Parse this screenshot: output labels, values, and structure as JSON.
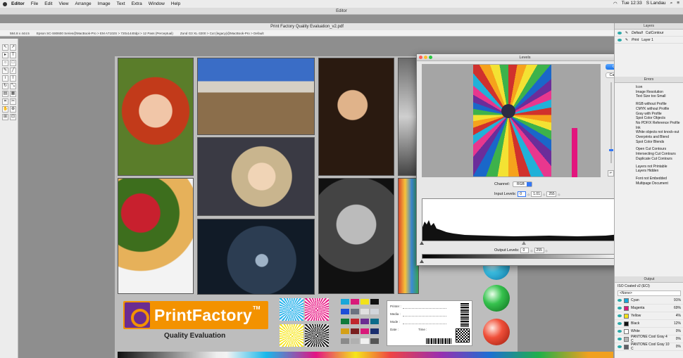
{
  "menubar": {
    "items": [
      "Editor",
      "File",
      "Edit",
      "View",
      "Arrange",
      "Image",
      "Text",
      "Extra",
      "Window",
      "Help"
    ],
    "clock": "Tue 12:33",
    "user": "S Landau"
  },
  "app_window": {
    "title": "Editor"
  },
  "document": {
    "title": "Print Factory Quality Evaluation_v2.pdf",
    "info": [
      "584.8 x 444.5",
      "Epson SC-S80600 Series@MacBook-Pro > EM A7102S > 720x1440dpi > 12 Pass (Perceptual)",
      "Zund G3 XL-3200 > Cut (legacy)@MacBook-Pro > Default"
    ]
  },
  "test_page": {
    "logo_text": "PrintFactory",
    "logo_tm": "TM",
    "subtitle": "Quality Evaluation",
    "form_fields": [
      "Printer :",
      "Media :",
      "Mode :",
      "Date :"
    ],
    "time_field": "Time :"
  },
  "levels_dialog": {
    "title": "Levels",
    "ok_label": "OK",
    "cancel_label": "Cancel",
    "zoom_max": "100%",
    "zoom_min": "4%",
    "channel_label": "Channel:",
    "channel_value": "RGB",
    "input_label": "Input Levels:",
    "input_black": "0",
    "input_gamma": "1.01",
    "input_white": "255",
    "output_label": "Output Levels:",
    "output_black": "0",
    "output_white": "255"
  },
  "layers_panel": {
    "title": "Layers",
    "rows": [
      {
        "name": "Default",
        "value": "CutContour"
      },
      {
        "name": "Print",
        "value": "Layer 1"
      }
    ]
  },
  "errors_panel": {
    "title": "Errors",
    "groups": [
      [
        "Icon",
        "Image Resolution",
        "Text Size too Small"
      ],
      [
        "RGB without Profile",
        "CMYK without Profile",
        "Gray with Profile",
        "Spot Color Objects",
        "No PDF/X Reference Profile",
        "Ink",
        "White objects not knock-out",
        "Overprints and Blend",
        "Spot Color Blends"
      ],
      [
        "Open Cut Contours",
        "Intersecting Cut Contours",
        "Duplicate Cut Contours"
      ],
      [
        "Layers not Printable",
        "Layers Hidden"
      ],
      [
        "Font not Embedded",
        "Multipage Document"
      ]
    ]
  },
  "output_panel": {
    "title": "Output",
    "profile": "ISO Coated v2 (ECI)",
    "none_option": "<None>",
    "inks": [
      {
        "name": "Cyan",
        "pct": "91%",
        "color": "#19a7d9"
      },
      {
        "name": "Magenta",
        "pct": "69%",
        "color": "#d9197a"
      },
      {
        "name": "Yellow",
        "pct": "4%",
        "color": "#f2e21a"
      },
      {
        "name": "Black",
        "pct": "12%",
        "color": "#111111"
      },
      {
        "name": "White",
        "pct": "0%",
        "color": "#ffffff"
      },
      {
        "name": "PANTONE Cool Gray 4 C",
        "pct": "0%",
        "color": "#b4b4b4"
      },
      {
        "name": "PANTONE Cool Gray 10 C",
        "pct": "0%",
        "color": "#5f5f66"
      }
    ]
  },
  "colors": {
    "accent": "#3478f6",
    "brand_orange": "#f39200",
    "brand_purple": "#6b2c91"
  }
}
